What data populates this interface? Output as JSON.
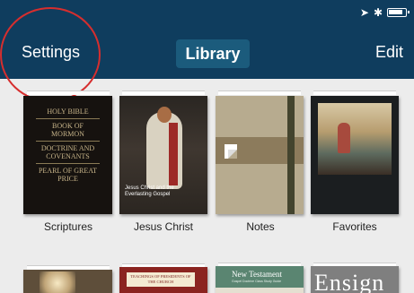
{
  "navbar": {
    "settings_label": "Settings",
    "library_label": "Library",
    "edit_label": "Edit"
  },
  "books_row1": [
    {
      "label": "Scriptures"
    },
    {
      "label": "Jesus Christ"
    },
    {
      "label": "Notes"
    },
    {
      "label": "Favorites"
    }
  ],
  "scriptures_cover": {
    "items": [
      "HOLY BIBLE",
      "BOOK OF MORMON",
      "DOCTRINE AND COVENANTS",
      "PEARL OF GREAT PRICE"
    ]
  },
  "jesus_cover": {
    "title": "Jesus Christ and the Everlasting Gospel"
  },
  "teachings_cover": {
    "title": "TEACHINGS OF PRESIDENTS OF THE CHURCH"
  },
  "newtestament_cover": {
    "title": "New Testament",
    "subtitle": "Gospel Doctrine Class Study Guide"
  },
  "ensign_cover": {
    "title": "Ensign"
  },
  "colors": {
    "navbar": "#0f3d5e",
    "library_button": "#1b5b7c",
    "annotation_circle": "#d62e2e"
  }
}
